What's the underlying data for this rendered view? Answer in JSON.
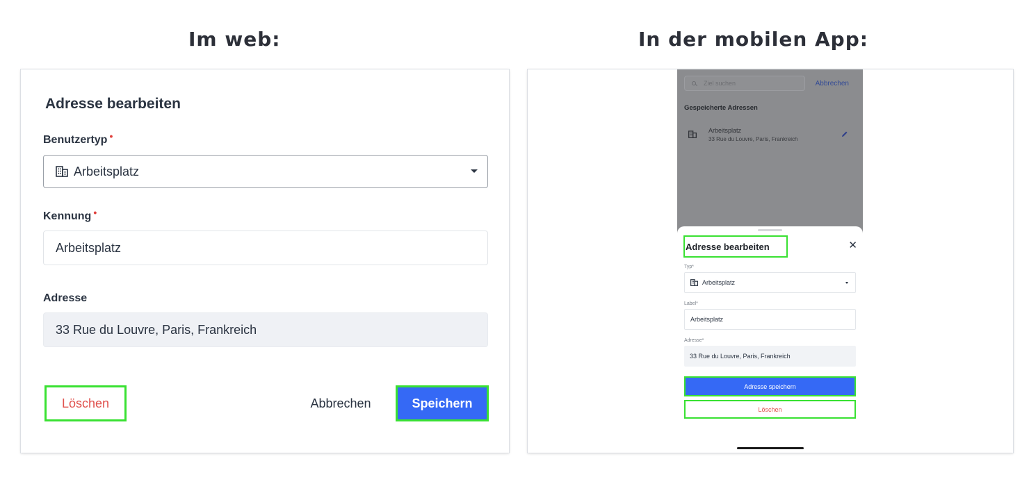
{
  "headings": {
    "web": "Im web:",
    "app": "In der mobilen App:"
  },
  "web": {
    "title": "Adresse bearbeiten",
    "required_mark": "•",
    "type_label": "Benutzertyp",
    "type_value": "Arbeitsplatz",
    "type_icon": "building-icon",
    "id_label": "Kennung",
    "id_value": "Arbeitsplatz",
    "address_label": "Adresse",
    "address_value": "33 Rue du Louvre, Paris, Frankreich",
    "delete_label": "Löschen",
    "cancel_label": "Abbrechen",
    "save_label": "Speichern"
  },
  "app": {
    "search_placeholder": "Ziel suchen",
    "search_cancel": "Abbrechen",
    "saved_title": "Gespeicherte Adressen",
    "saved_item": {
      "name": "Arbeitsplatz",
      "address": "33 Rue du Louvre, Paris, Frankreich"
    },
    "sheet": {
      "title": "Adresse bearbeiten",
      "close": "✕",
      "type_label": "Typ*",
      "type_value": "Arbeitsplatz",
      "label_label": "Label*",
      "label_value": "Arbeitsplatz",
      "address_label": "Adresse*",
      "address_value": "33 Rue du Louvre, Paris, Frankreich",
      "save_label": "Adresse speichern",
      "delete_label": "Löschen"
    }
  },
  "colors": {
    "primary": "#3569f5",
    "danger": "#e0514d",
    "highlight": "#39e132",
    "required": "#e0403c"
  }
}
